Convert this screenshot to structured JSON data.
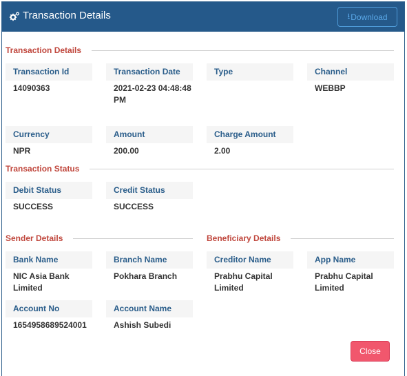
{
  "header": {
    "title": "Transaction Details",
    "download_label": "Download",
    "icon": "gears-icon",
    "download_icon": "download-icon"
  },
  "sections": {
    "transaction_details": "Transaction Details",
    "transaction_status": "Transaction Status",
    "sender_details": "Sender Details",
    "beneficiary_details": "Beneficiary Details"
  },
  "transaction": {
    "id_label": "Transaction Id",
    "id_value": "14090363",
    "date_label": "Transaction Date",
    "date_value": "2021-02-23 04:48:48 PM",
    "type_label": "Type",
    "type_value": "",
    "channel_label": "Channel",
    "channel_value": "WEBBP",
    "currency_label": "Currency",
    "currency_value": "NPR",
    "amount_label": "Amount",
    "amount_value": "200.00",
    "charge_label": "Charge Amount",
    "charge_value": "2.00"
  },
  "status": {
    "debit_label": "Debit Status",
    "debit_value": "SUCCESS",
    "credit_label": "Credit Status",
    "credit_value": "SUCCESS"
  },
  "sender": {
    "bank_label": "Bank Name",
    "bank_value": "NIC Asia Bank Limited",
    "branch_label": "Branch Name",
    "branch_value": "Pokhara Branch",
    "account_no_label": "Account No",
    "account_no_value": "1654958689524001",
    "account_name_label": "Account Name",
    "account_name_value": "Ashish Subedi"
  },
  "beneficiary": {
    "creditor_label": "Creditor Name",
    "creditor_value": "Prabhu Capital Limited",
    "app_label": "App Name",
    "app_value": "Prabhu Capital Limited"
  },
  "footer": {
    "close_label": "Close"
  },
  "colors": {
    "header_bg": "#25598a",
    "section_title": "#c0473d",
    "label_text": "#2a5d8a",
    "close_bg": "#f1576d"
  }
}
